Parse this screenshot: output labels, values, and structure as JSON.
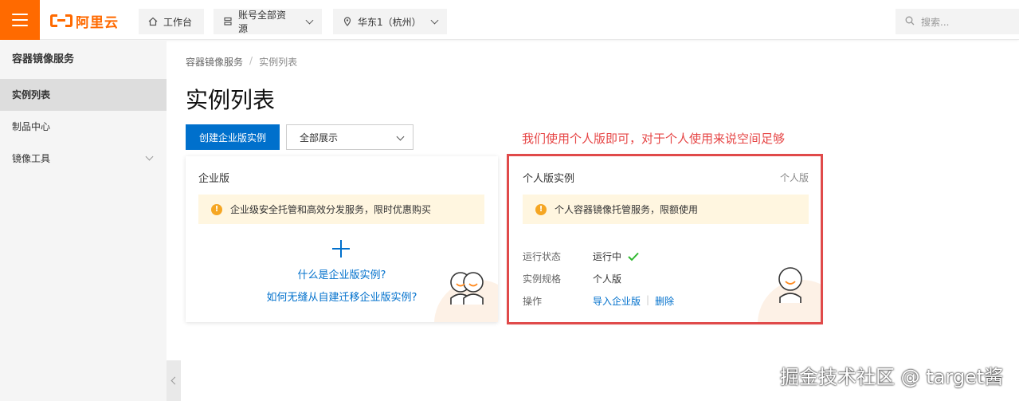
{
  "header": {
    "logo_text": "阿里云",
    "workbench_label": "工作台",
    "resources_label": "账号全部资源",
    "region_label": "华东1（杭州）",
    "search_placeholder": "搜索..."
  },
  "sidebar": {
    "title": "容器镜像服务",
    "items": [
      {
        "label": "实例列表",
        "active": true
      },
      {
        "label": "制品中心",
        "active": false
      },
      {
        "label": "镜像工具",
        "active": false,
        "expandable": true
      }
    ]
  },
  "breadcrumb": {
    "root": "容器镜像服务",
    "separator": "/",
    "current": "实例列表"
  },
  "page": {
    "title": "实例列表",
    "create_button": "创建企业版实例",
    "filter_value": "全部展示",
    "annotation": "我们使用个人版即可，对于个人使用来说空间足够"
  },
  "enterprise_card": {
    "title": "企业版",
    "notice": "企业级安全托管和高效分发服务，限时优惠购买",
    "link_what": "什么是企业版实例?",
    "link_migrate": "如何无缝从自建迁移企业版实例?"
  },
  "personal_card": {
    "title": "个人版实例",
    "tag": "个人版",
    "notice": "个人容器镜像托管服务，限额使用",
    "status_label": "运行状态",
    "status_value": "运行中",
    "spec_label": "实例规格",
    "spec_value": "个人版",
    "ops_label": "操作",
    "op_import": "导入企业版",
    "op_separator": "|",
    "op_delete": "删除"
  },
  "colors": {
    "brand": "#ff6a00",
    "primary": "#0070cc",
    "annotation": "#e64545",
    "success": "#2eb82e"
  },
  "watermark": "掘金技术社区 @ target酱"
}
